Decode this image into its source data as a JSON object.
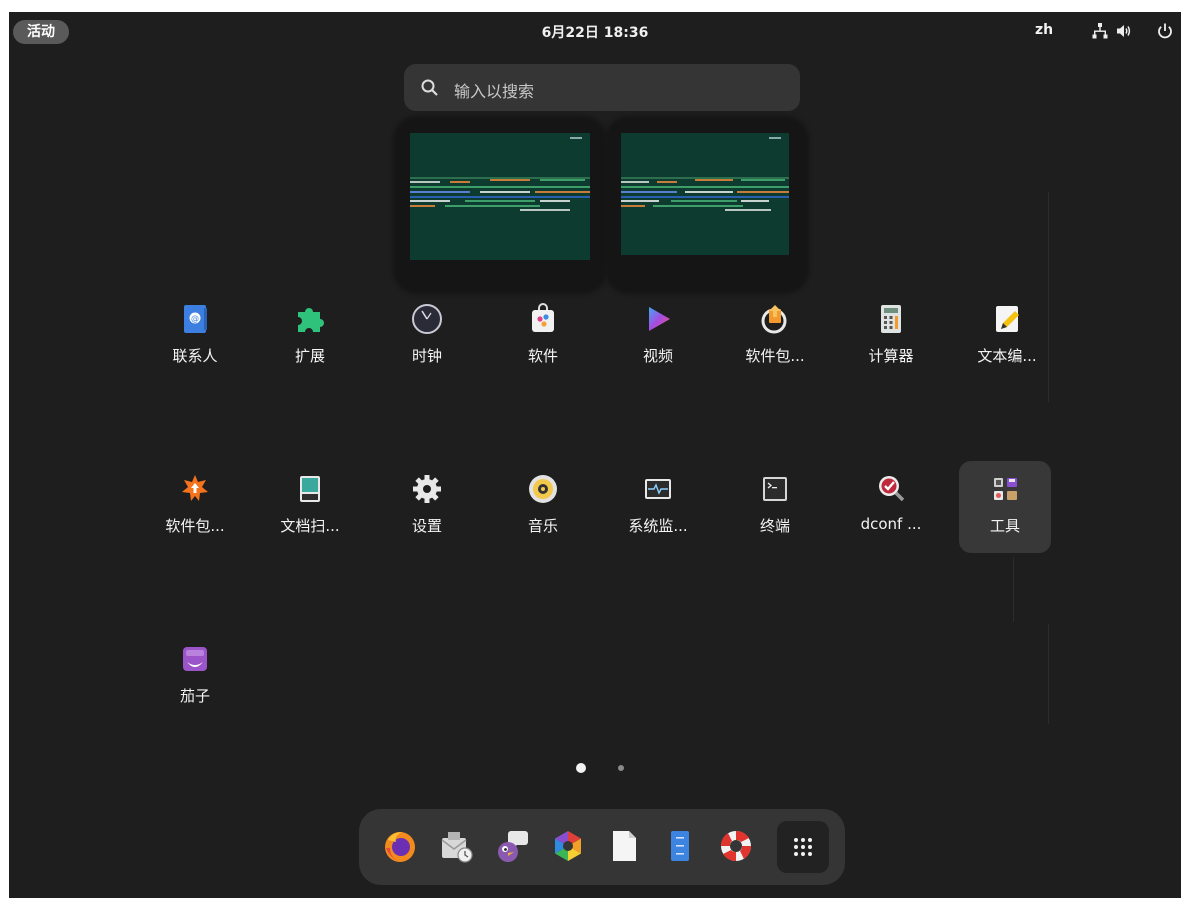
{
  "topbar": {
    "activities_label": "活动",
    "clock": "6月22日  18:36",
    "input_language": "zh"
  },
  "icons": {
    "network": "network-wired-icon",
    "volume": "volume-high-icon",
    "power": "power-icon",
    "search": "search-icon"
  },
  "search": {
    "placeholder": "输入以搜索"
  },
  "app_grid": {
    "row1": [
      "联系人",
      "扩展",
      "时钟",
      "软件",
      "视频",
      "软件包...",
      "计算器",
      "文本编..."
    ],
    "row2": [
      "软件包...",
      "文档扫...",
      "设置",
      "音乐",
      "系统监...",
      "终端",
      "dconf ...",
      "工具"
    ],
    "row3": [
      "茄子"
    ]
  },
  "pager": {
    "pages": 2,
    "current": 1
  },
  "dash": {
    "items": [
      "firefox-icon",
      "mail-clock-icon",
      "pidgin-icon",
      "color-hexagon-icon",
      "document-icon",
      "file-manager-icon",
      "help-lifebuoy-icon",
      "show-apps-icon"
    ]
  },
  "colors": {
    "panel": "#1e1e1e",
    "search_bg": "#353535",
    "workspace_bg": "#0d3b2f",
    "highlight": "#383838"
  }
}
